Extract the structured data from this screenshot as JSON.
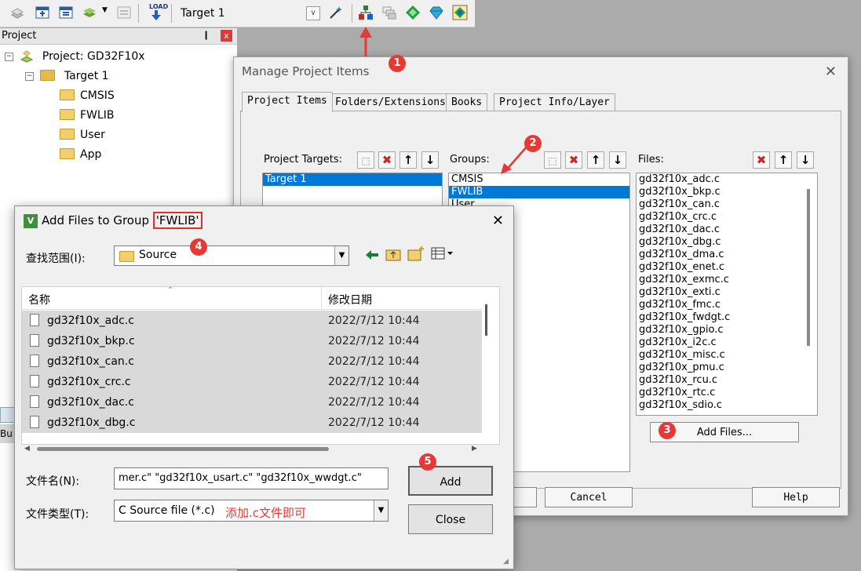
{
  "toolbar": {
    "target": "Target 1",
    "icons": [
      "translate-icon",
      "build-icon",
      "rebuild-icon",
      "batch-build-icon",
      "stop-build-icon",
      "load-icon",
      "magic-wand-icon",
      "manage-project-items-icon",
      "books-icon",
      "pack-installer-icon",
      "select-packs-icon",
      "run-time-environment-icon"
    ],
    "load_label": "LOAD"
  },
  "project_panel": {
    "title": "Project",
    "pin": "❙",
    "close": "x",
    "root": "Project: GD32F10x",
    "target": "Target 1",
    "groups": [
      "CMSIS",
      "FWLIB",
      "User",
      "App"
    ],
    "expand_sign": "−"
  },
  "manage_dialog": {
    "title": "Manage Project Items",
    "close": "✕",
    "tabs": [
      "Project Items",
      "Folders/Extensions",
      "Books",
      "Project Info/Layer"
    ],
    "targets_label": "Project Targets:",
    "targets": [
      "Target 1"
    ],
    "groups_label": "Groups:",
    "groups": [
      "CMSIS",
      "FWLIB",
      "User"
    ],
    "files_label": "Files:",
    "files": [
      "gd32f10x_adc.c",
      "gd32f10x_bkp.c",
      "gd32f10x_can.c",
      "gd32f10x_crc.c",
      "gd32f10x_dac.c",
      "gd32f10x_dbg.c",
      "gd32f10x_dma.c",
      "gd32f10x_enet.c",
      "gd32f10x_exmc.c",
      "gd32f10x_exti.c",
      "gd32f10x_fmc.c",
      "gd32f10x_fwdgt.c",
      "gd32f10x_gpio.c",
      "gd32f10x_i2c.c",
      "gd32f10x_misc.c",
      "gd32f10x_pmu.c",
      "gd32f10x_rcu.c",
      "gd32f10x_rtc.c",
      "gd32f10x_sdio.c"
    ],
    "add_files": "Add Files...",
    "cancel": "Cancel",
    "help": "Help",
    "new_glyph": "⬚",
    "delete_glyph": "✖",
    "up_glyph": "↑",
    "down_glyph": "↓"
  },
  "add_dialog": {
    "title_prefix": "Add Files to Group ",
    "title_group": "'FWLIB'",
    "app_icon": "V",
    "close": "✕",
    "look_in_label": "查找范围(I):",
    "look_in_value": "Source",
    "col_name": "名称",
    "col_date": "修改日期",
    "sort_glyph": "˄",
    "rows": [
      {
        "name": "gd32f10x_adc.c",
        "date": "2022/7/12 10:44"
      },
      {
        "name": "gd32f10x_bkp.c",
        "date": "2022/7/12 10:44"
      },
      {
        "name": "gd32f10x_can.c",
        "date": "2022/7/12 10:44"
      },
      {
        "name": "gd32f10x_crc.c",
        "date": "2022/7/12 10:44"
      },
      {
        "name": "gd32f10x_dac.c",
        "date": "2022/7/12 10:44"
      },
      {
        "name": "gd32f10x_dbg.c",
        "date": "2022/7/12 10:44"
      }
    ],
    "filename_label": "文件名(N):",
    "filename_value": "mer.c\" \"gd32f10x_usart.c\" \"gd32f10x_wwdgt.c\"",
    "filetype_label": "文件类型(T):",
    "filetype_value": "C Source file (*.c)",
    "add_button": "Add",
    "close_button": "Close",
    "note": "添加.c文件即可",
    "note_color": "#e53935"
  },
  "callouts": [
    "1",
    "2",
    "3",
    "4",
    "5"
  ],
  "partial_labels": {
    "bu": "Bu"
  }
}
